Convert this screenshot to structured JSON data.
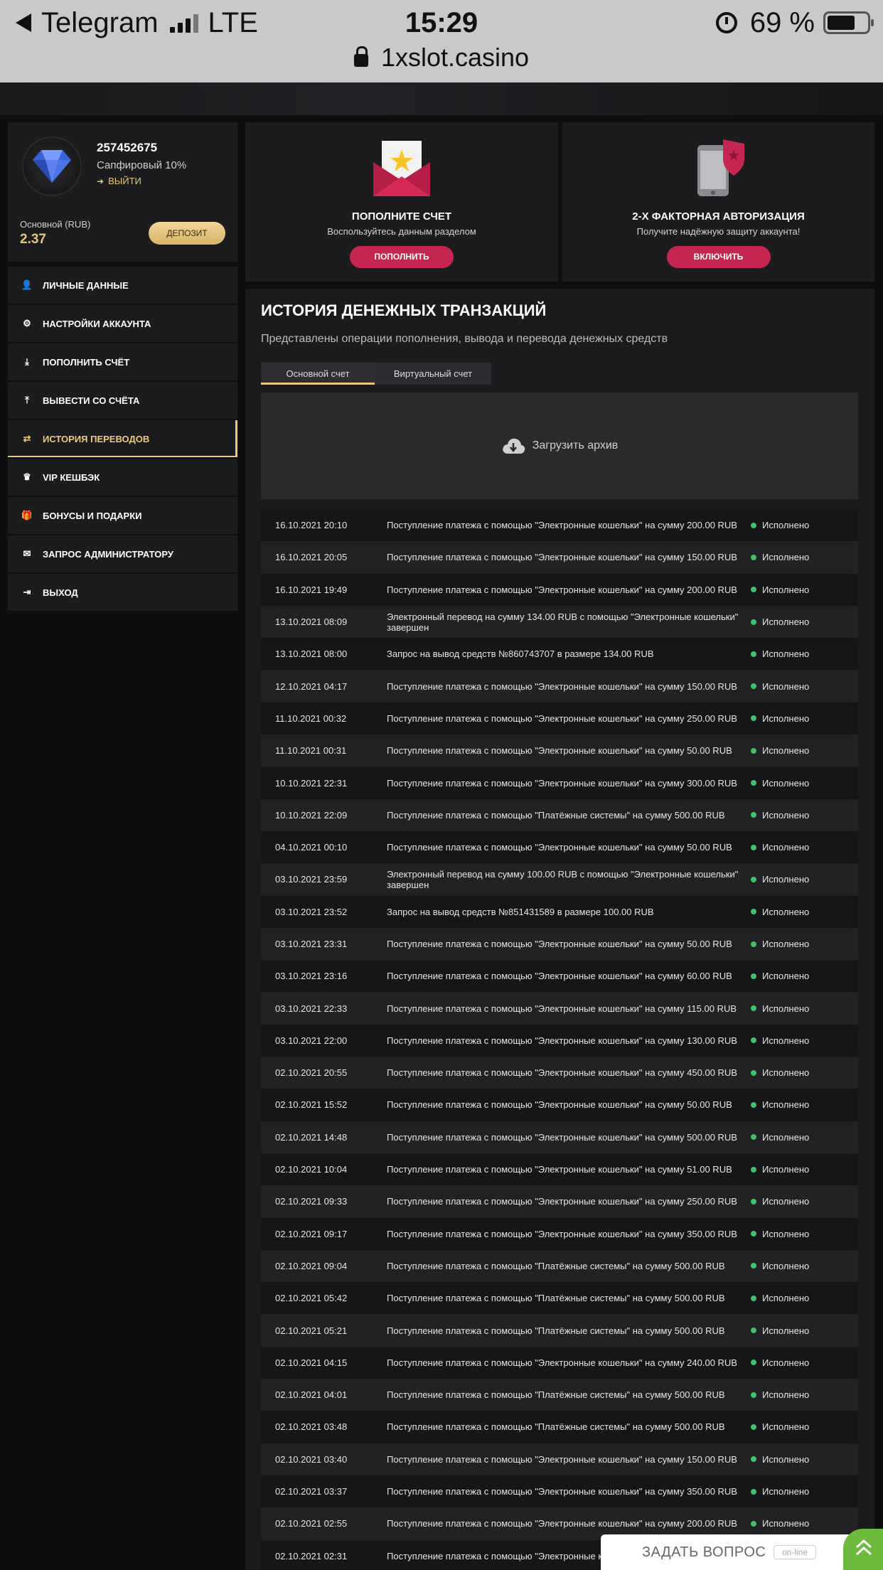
{
  "statusbar": {
    "app": "Telegram",
    "network": "LTE",
    "time": "15:29",
    "battery": "69 %",
    "url": "1xslot.casino"
  },
  "profile": {
    "id": "257452675",
    "level": "Сапфировый 10%",
    "logout": "ВЫЙТИ",
    "balance_label": "Основной (RUB)",
    "balance": "2.37",
    "deposit_button": "ДЕПОЗИТ"
  },
  "menu": [
    {
      "label": "ЛИЧНЫЕ ДАННЫЕ",
      "icon": "user-plus-icon"
    },
    {
      "label": "НАСТРОЙКИ АККАУНТА",
      "icon": "gears-icon"
    },
    {
      "label": "ПОПОЛНИТЬ СЧЁТ",
      "icon": "download-icon"
    },
    {
      "label": "ВЫВЕСТИ СО СЧЁТА",
      "icon": "upload-icon"
    },
    {
      "label": "ИСТОРИЯ ПЕРЕВОДОВ",
      "icon": "transfer-icon",
      "active": true
    },
    {
      "label": "VIP КЕШБЭК",
      "icon": "crown-icon"
    },
    {
      "label": "БОНУСЫ И ПОДАРКИ",
      "icon": "gift-icon"
    },
    {
      "label": "ЗАПРОС АДМИНИСТРАТОРУ",
      "icon": "envelope-icon"
    },
    {
      "label": "ВЫХОД",
      "icon": "sign-out-icon"
    }
  ],
  "promo_deposit": {
    "title": "ПОПОЛНИТЕ СЧЕТ",
    "subtitle": "Воспользуйтесь данным разделом",
    "button": "ПОПОЛНИТЬ"
  },
  "promo_2fa": {
    "title": "2-Х ФАКТОРНАЯ АВТОРИЗАЦИЯ",
    "subtitle": "Получите надёжную защиту аккаунта!",
    "button": "ВКЛЮЧИТЬ"
  },
  "history": {
    "title": "ИСТОРИЯ ДЕНЕЖНЫХ ТРАНЗАКЦИЙ",
    "subtitle": "Представлены операции пополнения, вывода и перевода денежных средств",
    "tabs": [
      "Основной счет",
      "Виртуальный счет"
    ],
    "archive": "Загрузить архив",
    "rows": [
      {
        "date": "16.10.2021 20:10",
        "desc": "Поступление платежа с помощью \"Электронные кошельки\" на сумму 200.00 RUB",
        "status": "Исполнено"
      },
      {
        "date": "16.10.2021 20:05",
        "desc": "Поступление платежа с помощью \"Электронные кошельки\" на сумму 150.00 RUB",
        "status": "Исполнено"
      },
      {
        "date": "16.10.2021 19:49",
        "desc": "Поступление платежа с помощью \"Электронные кошельки\" на сумму 200.00 RUB",
        "status": "Исполнено"
      },
      {
        "date": "13.10.2021 08:09",
        "desc": "Электронный перевод на сумму 134.00 RUB с помощью \"Электронные кошельки\" завершен",
        "status": "Исполнено"
      },
      {
        "date": "13.10.2021 08:00",
        "desc": "Запрос на вывод средств №860743707 в размере 134.00 RUB",
        "status": "Исполнено"
      },
      {
        "date": "12.10.2021 04:17",
        "desc": "Поступление платежа с помощью \"Электронные кошельки\" на сумму 150.00 RUB",
        "status": "Исполнено"
      },
      {
        "date": "11.10.2021 00:32",
        "desc": "Поступление платежа с помощью \"Электронные кошельки\" на сумму 250.00 RUB",
        "status": "Исполнено"
      },
      {
        "date": "11.10.2021 00:31",
        "desc": "Поступление платежа с помощью \"Электронные кошельки\" на сумму 50.00 RUB",
        "status": "Исполнено"
      },
      {
        "date": "10.10.2021 22:31",
        "desc": "Поступление платежа с помощью \"Электронные кошельки\" на сумму 300.00 RUB",
        "status": "Исполнено"
      },
      {
        "date": "10.10.2021 22:09",
        "desc": "Поступление платежа с помощью \"Платёжные системы\" на сумму 500.00 RUB",
        "status": "Исполнено"
      },
      {
        "date": "04.10.2021 00:10",
        "desc": "Поступление платежа с помощью \"Электронные кошельки\" на сумму 50.00 RUB",
        "status": "Исполнено"
      },
      {
        "date": "03.10.2021 23:59",
        "desc": "Электронный перевод на сумму 100.00 RUB с помощью \"Электронные кошельки\" завершен",
        "status": "Исполнено"
      },
      {
        "date": "03.10.2021 23:52",
        "desc": "Запрос на вывод средств №851431589 в размере 100.00 RUB",
        "status": "Исполнено"
      },
      {
        "date": "03.10.2021 23:31",
        "desc": "Поступление платежа с помощью \"Электронные кошельки\" на сумму 50.00 RUB",
        "status": "Исполнено"
      },
      {
        "date": "03.10.2021 23:16",
        "desc": "Поступление платежа с помощью \"Электронные кошельки\" на сумму 60.00 RUB",
        "status": "Исполнено"
      },
      {
        "date": "03.10.2021 22:33",
        "desc": "Поступление платежа с помощью \"Электронные кошельки\" на сумму 115.00 RUB",
        "status": "Исполнено"
      },
      {
        "date": "03.10.2021 22:00",
        "desc": "Поступление платежа с помощью \"Электронные кошельки\" на сумму 130.00 RUB",
        "status": "Исполнено"
      },
      {
        "date": "02.10.2021 20:55",
        "desc": "Поступление платежа с помощью \"Электронные кошельки\" на сумму 450.00 RUB",
        "status": "Исполнено"
      },
      {
        "date": "02.10.2021 15:52",
        "desc": "Поступление платежа с помощью \"Электронные кошельки\" на сумму 50.00 RUB",
        "status": "Исполнено"
      },
      {
        "date": "02.10.2021 14:48",
        "desc": "Поступление платежа с помощью \"Электронные кошельки\" на сумму 500.00 RUB",
        "status": "Исполнено"
      },
      {
        "date": "02.10.2021 10:04",
        "desc": "Поступление платежа с помощью \"Электронные кошельки\" на сумму 51.00 RUB",
        "status": "Исполнено"
      },
      {
        "date": "02.10.2021 09:33",
        "desc": "Поступление платежа с помощью \"Электронные кошельки\" на сумму 250.00 RUB",
        "status": "Исполнено"
      },
      {
        "date": "02.10.2021 09:17",
        "desc": "Поступление платежа с помощью \"Электронные кошельки\" на сумму 350.00 RUB",
        "status": "Исполнено"
      },
      {
        "date": "02.10.2021 09:04",
        "desc": "Поступление платежа с помощью \"Платёжные системы\" на сумму 500.00 RUB",
        "status": "Исполнено"
      },
      {
        "date": "02.10.2021 05:42",
        "desc": "Поступление платежа с помощью \"Платёжные системы\" на сумму 500.00 RUB",
        "status": "Исполнено"
      },
      {
        "date": "02.10.2021 05:21",
        "desc": "Поступление платежа с помощью \"Платёжные системы\" на сумму 500.00 RUB",
        "status": "Исполнено"
      },
      {
        "date": "02.10.2021 04:15",
        "desc": "Поступление платежа с помощью \"Электронные кошельки\" на сумму 240.00 RUB",
        "status": "Исполнено"
      },
      {
        "date": "02.10.2021 04:01",
        "desc": "Поступление платежа с помощью \"Платёжные системы\" на сумму 500.00 RUB",
        "status": "Исполнено"
      },
      {
        "date": "02.10.2021 03:48",
        "desc": "Поступление платежа с помощью \"Платёжные системы\" на сумму 500.00 RUB",
        "status": "Исполнено"
      },
      {
        "date": "02.10.2021 03:40",
        "desc": "Поступление платежа с помощью \"Электронные кошельки\" на сумму 150.00 RUB",
        "status": "Исполнено"
      },
      {
        "date": "02.10.2021 03:37",
        "desc": "Поступление платежа с помощью \"Электронные кошельки\" на сумму 350.00 RUB",
        "status": "Исполнено"
      },
      {
        "date": "02.10.2021 02:55",
        "desc": "Поступление платежа с помощью \"Электронные кошельки\" на сумму 200.00 RUB",
        "status": "Исполнено"
      },
      {
        "date": "02.10.2021 02:31",
        "desc": "Поступление платежа с помощью \"Электронные кошельки\" на сумму",
        "status": ""
      }
    ]
  },
  "ask_widget": {
    "label": "ЗАДАТЬ ВОПРОС",
    "status": "on-line"
  },
  "colors": {
    "accent_gold": "#e8c47f",
    "accent_red": "#c4264f",
    "status_green": "#43c06a"
  }
}
